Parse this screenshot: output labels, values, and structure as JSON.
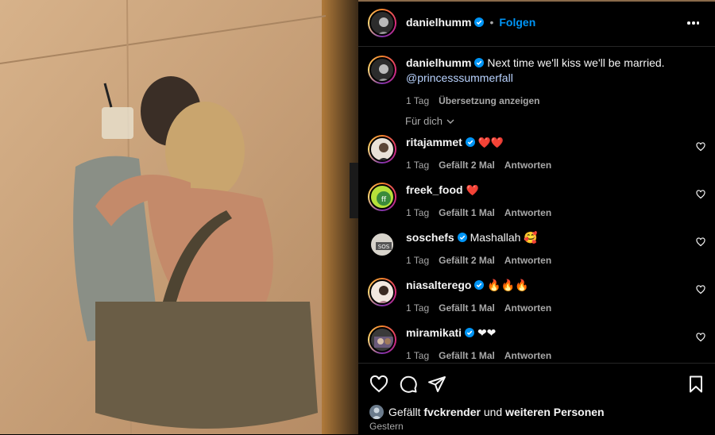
{
  "post": {
    "author": "danielhumm",
    "follow_label": "Folgen",
    "dot": "•",
    "caption": {
      "author": "danielhumm",
      "text": "Next time we'll kiss we'll be married.",
      "mention": "@princesssummerfall",
      "time": "1 Tag",
      "translate": "Übersetzung anzeigen"
    }
  },
  "filter": {
    "label": "Für dich"
  },
  "comments": [
    {
      "user": "ritajammet",
      "verified": true,
      "text": "❤️❤️",
      "time": "1 Tag",
      "likes": "Gefällt 2 Mal",
      "reply": "Antworten"
    },
    {
      "user": "freek_food",
      "verified": false,
      "text": "❤️",
      "time": "1 Tag",
      "likes": "Gefällt 1 Mal",
      "reply": "Antworten"
    },
    {
      "user": "soschefs",
      "verified": true,
      "text": "Mashallah 🥰",
      "time": "1 Tag",
      "likes": "Gefällt 2 Mal",
      "reply": "Antworten"
    },
    {
      "user": "niasalterego",
      "verified": true,
      "text": "🔥🔥🔥",
      "time": "1 Tag",
      "likes": "Gefällt 1 Mal",
      "reply": "Antworten"
    },
    {
      "user": "miramikati",
      "verified": true,
      "text": "❤❤",
      "time": "1 Tag",
      "likes": "Gefällt 1 Mal",
      "reply": "Antworten"
    }
  ],
  "footer": {
    "liked_prefix": "Gefällt",
    "liked_user": "fvckrender",
    "liked_and": "und",
    "liked_others": "weiteren Personen",
    "date": "Gestern"
  },
  "colors": {
    "accent": "#0095f6",
    "verified": "#0095f6",
    "background": "#000000"
  }
}
